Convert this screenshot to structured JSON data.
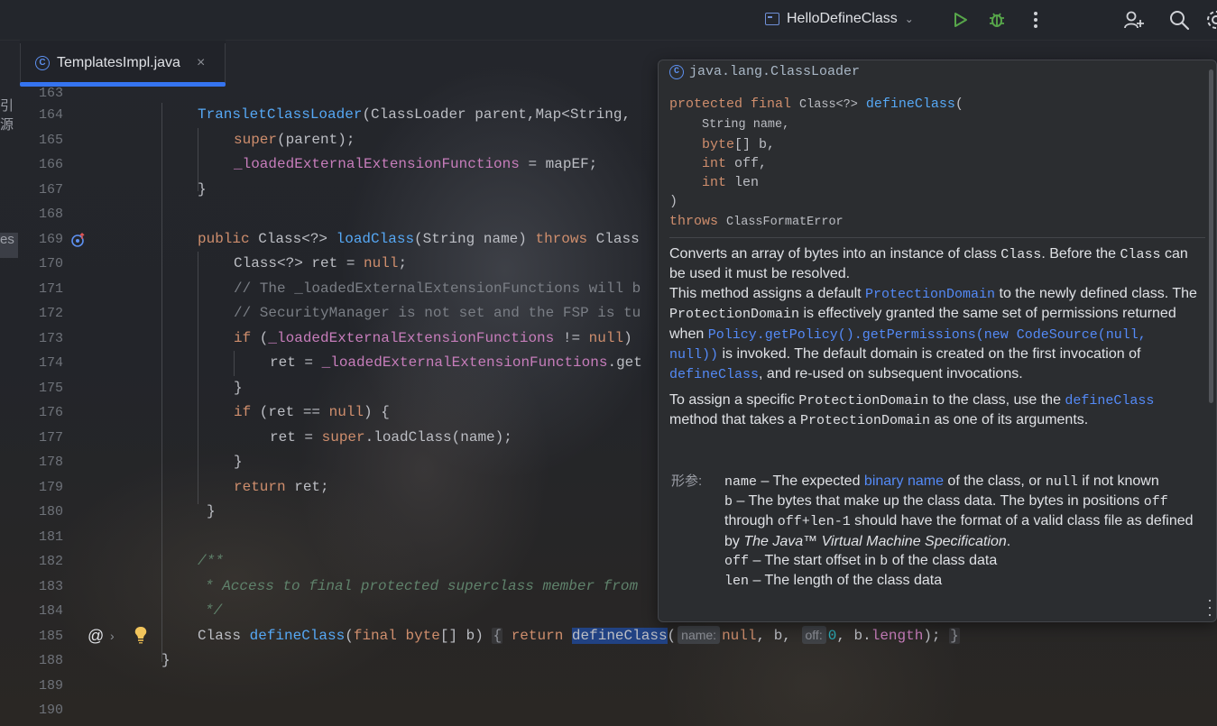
{
  "toolbar": {
    "run_config": "HelloDefineClass",
    "icons": [
      "run-icon",
      "debug-icon",
      "more-icon",
      "add-user-icon",
      "search-icon",
      "settings-icon"
    ]
  },
  "tab": {
    "file_name": "TemplatesImpl.java",
    "close": "×"
  },
  "left_strip": {
    "fragment1": "引源",
    "fragment2": "es"
  },
  "editor": {
    "lines": [
      {
        "n": "163"
      },
      {
        "n": "164"
      },
      {
        "n": "165"
      },
      {
        "n": "166"
      },
      {
        "n": "167"
      },
      {
        "n": "168"
      },
      {
        "n": "169"
      },
      {
        "n": "170"
      },
      {
        "n": "171"
      },
      {
        "n": "172"
      },
      {
        "n": "173"
      },
      {
        "n": "174"
      },
      {
        "n": "175"
      },
      {
        "n": "176"
      },
      {
        "n": "177"
      },
      {
        "n": "178"
      },
      {
        "n": "179"
      },
      {
        "n": "180"
      },
      {
        "n": "181"
      },
      {
        "n": "182"
      },
      {
        "n": "183"
      },
      {
        "n": "184"
      },
      {
        "n": "185"
      },
      {
        "n": "188"
      },
      {
        "n": "189"
      },
      {
        "n": "190"
      }
    ],
    "hints": {
      "name": "name:",
      "off": "off:"
    }
  },
  "doc_popup": {
    "header": "java.lang.ClassLoader",
    "signature": {
      "modifiers": "protected final",
      "return_type": "Class<?>",
      "method": "defineClass",
      "open": "(",
      "p1": "String name,",
      "p2_type": "byte",
      "p2_rest": "[] b,",
      "p3_type": "int",
      "p3_rest": " off,",
      "p4_type": "int",
      "p4_rest": " len",
      "close": ")",
      "throws_kw": "throws",
      "throws_type": "ClassFormatError"
    },
    "description": {
      "p1_a": "Converts an array of bytes into an instance of class ",
      "p1_code": "Class",
      "p1_b": ". Before the ",
      "p1_code2": "Class",
      "p1_c": " can be used it must be resolved.",
      "p2_a": "This method assigns a default ",
      "p2_link": "ProtectionDomain",
      "p2_b": " to the newly defined class. The ",
      "p2_code": "ProtectionDomain",
      "p2_c": " is effectively granted the same set of permissions returned when ",
      "p2_link2": "Policy.getPolicy().getPermissions(new CodeSource(null, null))",
      "p2_d": " is invoked. The default domain is created on the first invocation of ",
      "p2_link3": "defineClass",
      "p2_e": ", and re-used on subsequent invocations.",
      "p3_a": "To assign a specific ",
      "p3_code": "ProtectionDomain",
      "p3_b": " to the class, use the ",
      "p3_link": "defineClass",
      "p3_c": " method that takes a ",
      "p3_code2": "ProtectionDomain",
      "p3_d": " as one of its arguments."
    },
    "params": {
      "label": "形参:",
      "name_code": "name",
      "name_a": " – The expected ",
      "name_link": "binary name",
      "name_b": " of the class, or ",
      "name_code2": "null",
      "name_c": " if not known",
      "b_code": "b",
      "b_a": " – The bytes that make up the class data. The bytes in positions ",
      "b_code2": "off",
      "b_b": " through ",
      "b_code3": "off+len-1",
      "b_c": " should have the format of a valid class file as defined by ",
      "b_em": "The Java™ Virtual Machine Specification",
      "b_d": ".",
      "off_code": "off",
      "off_a": " – The start offset in ",
      "off_code2": "b",
      "off_b": " of the class data",
      "len_code": "len",
      "len_a": " – The length of the class data"
    }
  }
}
